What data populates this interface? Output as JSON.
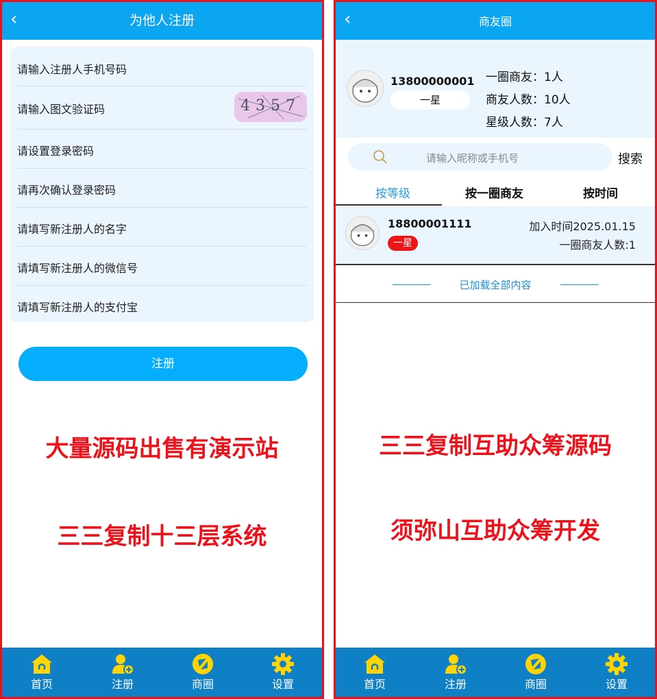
{
  "left": {
    "header": {
      "back": "‹",
      "title": "为他人注册"
    },
    "form": {
      "phone": "请输入注册人手机号码",
      "captcha_label": "请输入图文验证码",
      "captcha_code": "4357",
      "password": "请设置登录密码",
      "confirm": "请再次确认登录密码",
      "name": "请填写新注册人的名字",
      "wechat": "请填写新注册人的微信号",
      "alipay": "请填写新注册人的支付宝"
    },
    "register_button": "注册",
    "promo": {
      "line1": "大量源码出售有演示站",
      "line2": "三三复制十三层系统"
    }
  },
  "right": {
    "header": {
      "back": "‹",
      "title": "商友圈"
    },
    "profile": {
      "phone": "13800000001",
      "level": "一星",
      "stats": {
        "first_circle": "一圈商友：1人",
        "friends": "商友人数：10人",
        "star": "星级人数：7人"
      }
    },
    "search": {
      "placeholder": "请输入昵称或手机号",
      "button": "搜索"
    },
    "tabs": [
      "按等级",
      "按一圈商友",
      "按时间"
    ],
    "member": {
      "phone": "18800001111",
      "level": "一星",
      "joined": "加入时间2025.01.15",
      "circle": "一圈商友人数:1"
    },
    "loaded_text": "已加载全部内容",
    "promo": {
      "line1": "三三复制互助众筹源码",
      "line2": "须弥山互助众筹开发"
    }
  },
  "nav": {
    "home": "首页",
    "register": "注册",
    "circle": "商圈",
    "settings": "设置"
  },
  "colors": {
    "header": "#0ba6f2",
    "nav": "#0f80c6",
    "promo": "#f0101a",
    "icon": "#ffd400",
    "accent": "#05aefc"
  }
}
